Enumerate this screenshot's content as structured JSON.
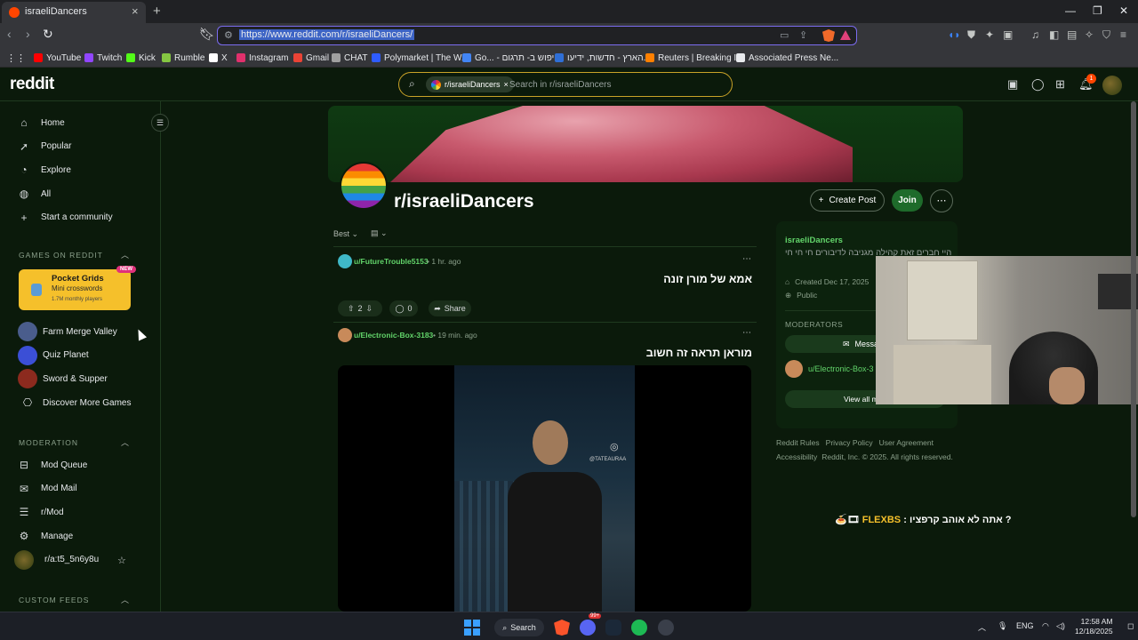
{
  "browser": {
    "tab_title": "israeliDancers",
    "url": "https://www.reddit.com/r/israeliDancers/",
    "bookmarks": [
      {
        "label": "YouTube",
        "color": "#ff0000"
      },
      {
        "label": "Twitch",
        "color": "#9146ff"
      },
      {
        "label": "Kick",
        "color": "#53fc18"
      },
      {
        "label": "Rumble",
        "color": "#85c742"
      },
      {
        "label": "X",
        "color": "#ffffff"
      },
      {
        "label": "Instagram",
        "color": "#e1306c"
      },
      {
        "label": "Gmail",
        "color": "#ea4335"
      },
      {
        "label": "CHAT",
        "color": "#a0a0a0"
      },
      {
        "label": "Polymarket | The W...",
        "color": "#2e5cff"
      },
      {
        "label": "Go... - חיפוש ב- תרגום",
        "color": "#4285f4"
      },
      {
        "label": "הארץ - חדשות, ידיעו...",
        "color": "#2f6fd6"
      },
      {
        "label": "Reuters | Breaking I...",
        "color": "#ff8000"
      },
      {
        "label": "Associated Press Ne...",
        "color": "#e8eaed"
      }
    ]
  },
  "header": {
    "logo": "reddit",
    "search_chip": "r/israeliDancers",
    "search_placeholder": "Search in r/israeliDancers",
    "notification_count": "1"
  },
  "sidebar": {
    "nav": [
      {
        "label": "Home",
        "icon": "home-icon"
      },
      {
        "label": "Popular",
        "icon": "popular-icon"
      },
      {
        "label": "Explore",
        "icon": "explore-icon"
      },
      {
        "label": "All",
        "icon": "all-icon"
      },
      {
        "label": "Start a community",
        "icon": "plus-icon"
      }
    ],
    "games_heading": "GAMES ON REDDIT",
    "featured_game": {
      "title": "Pocket Grids",
      "subtitle": "Mini crosswords",
      "players": "1.7M monthly players",
      "badge": "NEW"
    },
    "games": [
      {
        "label": "Farm Merge Valley",
        "color": "#4a5d8c"
      },
      {
        "label": "Quiz Planet",
        "color": "#3b4fd6"
      },
      {
        "label": "Sword & Supper",
        "color": "#8c2a1e"
      },
      {
        "label": "Discover More Games",
        "color": ""
      }
    ],
    "moderation_heading": "MODERATION",
    "moderation": [
      {
        "label": "Mod Queue",
        "icon": "queue-icon"
      },
      {
        "label": "Mod Mail",
        "icon": "mail-icon"
      },
      {
        "label": "r/Mod",
        "icon": "mod-icon"
      },
      {
        "label": "Manage",
        "icon": "gear-icon"
      },
      {
        "label": "r/a:t5_5n6y8u",
        "icon": "community-avatar"
      }
    ],
    "custom_feeds_heading": "CUSTOM FEEDS"
  },
  "community": {
    "name": "r/israeliDancers",
    "create_post": "Create Post",
    "join": "Join",
    "sort": "Best"
  },
  "posts": [
    {
      "user": "u/FutureTrouble5153",
      "time": "• 1 hr. ago",
      "title": "אמא של מורן זונה",
      "votes": "2",
      "comments": "0",
      "share": "Share",
      "avatar_color": "#3fb8c8"
    },
    {
      "user": "u/Electronic-Box-3183",
      "time": "• 19 min. ago",
      "title": "מוראן תראה זה חשוב",
      "avatar_color": "#c88a5a",
      "watermark": "@TATEAURAA"
    }
  ],
  "about": {
    "name": "israeliDancers",
    "description": "היי חברים זאת קהילה מגניבה לדיבורים חי חי חי",
    "created": "Created Dec 17, 2025",
    "visibility": "Public",
    "moderators_heading": "MODERATORS",
    "message_btn": "Message",
    "moderator": "u/Electronic-Box-3",
    "view_all": "View all mod"
  },
  "footer": {
    "links": [
      "Reddit Rules",
      "Privacy Policy",
      "User Agreement"
    ],
    "accessibility": "Accessibility",
    "copyright": "Reddit, Inc. © 2025. All rights reserved."
  },
  "overlay": {
    "emoji": "🍝🎞",
    "flex": "FLEXBS",
    "text": ": אתה לא אוהב קרפציו ?"
  },
  "taskbar": {
    "search": "Search",
    "lang": "ENG",
    "time": "12:58 AM",
    "date": "12/18/2025",
    "discord_badge": "99+"
  }
}
